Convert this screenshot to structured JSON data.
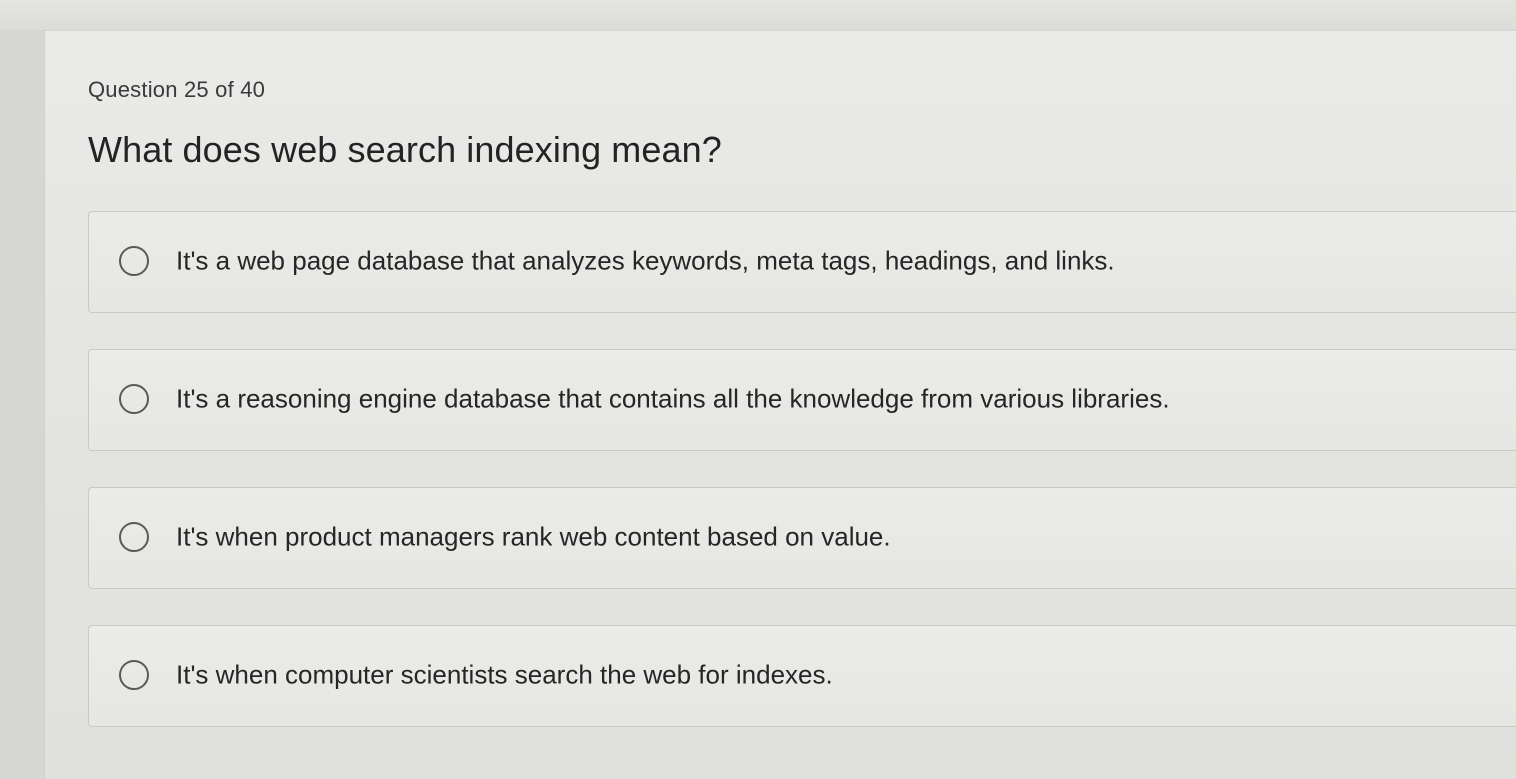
{
  "quiz": {
    "counter": "Question 25 of 40",
    "question": "What does web search indexing mean?",
    "options": [
      {
        "label": "It's a web page database that analyzes keywords, meta tags, headings, and links.",
        "selected": false
      },
      {
        "label": "It's a reasoning engine database that contains all the knowledge from various libraries.",
        "selected": false
      },
      {
        "label": "It's when product managers rank web content based on value.",
        "selected": false
      },
      {
        "label": "It's when computer scientists search the web for indexes.",
        "selected": false
      }
    ]
  },
  "icons": {
    "radio": "radio-unselected-icon"
  },
  "colors": {
    "page_background": "#e8e8e6",
    "text": "#262626",
    "border": "#c9c9c5"
  }
}
